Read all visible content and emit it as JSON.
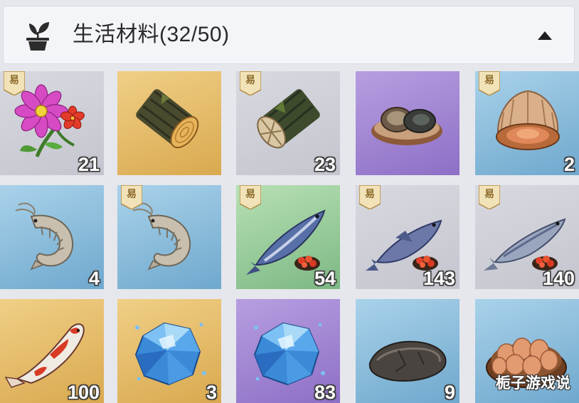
{
  "header": {
    "title": "生活材料(32/50)",
    "icon": "potted-plant-icon",
    "collapse_icon": "triangle-up-icon"
  },
  "badge_label": "易",
  "watermark": "栀子游戏说",
  "colors": {
    "gray": "#c8c9d2",
    "gold": "#e4b968",
    "purple": "#a186d6",
    "blue": "#8cc0de",
    "green": "#9ccc9c"
  },
  "items": [
    {
      "name": "flower",
      "rarity": "gray",
      "badge": true,
      "count": "21"
    },
    {
      "name": "log-gold",
      "rarity": "gold",
      "badge": false,
      "count": ""
    },
    {
      "name": "log-gray",
      "rarity": "gray",
      "badge": true,
      "count": "23"
    },
    {
      "name": "abalone",
      "rarity": "purple",
      "badge": false,
      "count": ""
    },
    {
      "name": "clam",
      "rarity": "blue",
      "badge": true,
      "count": "2"
    },
    {
      "name": "shrimp",
      "rarity": "blue",
      "badge": false,
      "count": "4"
    },
    {
      "name": "shrimp",
      "rarity": "blue",
      "badge": true,
      "count": ""
    },
    {
      "name": "salmon",
      "rarity": "green",
      "badge": true,
      "count": "54"
    },
    {
      "name": "perch",
      "rarity": "gray",
      "badge": true,
      "count": "143"
    },
    {
      "name": "sardine",
      "rarity": "gray",
      "badge": true,
      "count": "140"
    },
    {
      "name": "koi",
      "rarity": "gold",
      "badge": false,
      "count": "100"
    },
    {
      "name": "crystal-ore",
      "rarity": "gold",
      "badge": false,
      "count": "3"
    },
    {
      "name": "crystal-ore",
      "rarity": "purple",
      "badge": false,
      "count": "83"
    },
    {
      "name": "stone",
      "rarity": "blue",
      "badge": false,
      "count": "9"
    },
    {
      "name": "egg-basket",
      "rarity": "blue",
      "badge": false,
      "count": ""
    }
  ]
}
